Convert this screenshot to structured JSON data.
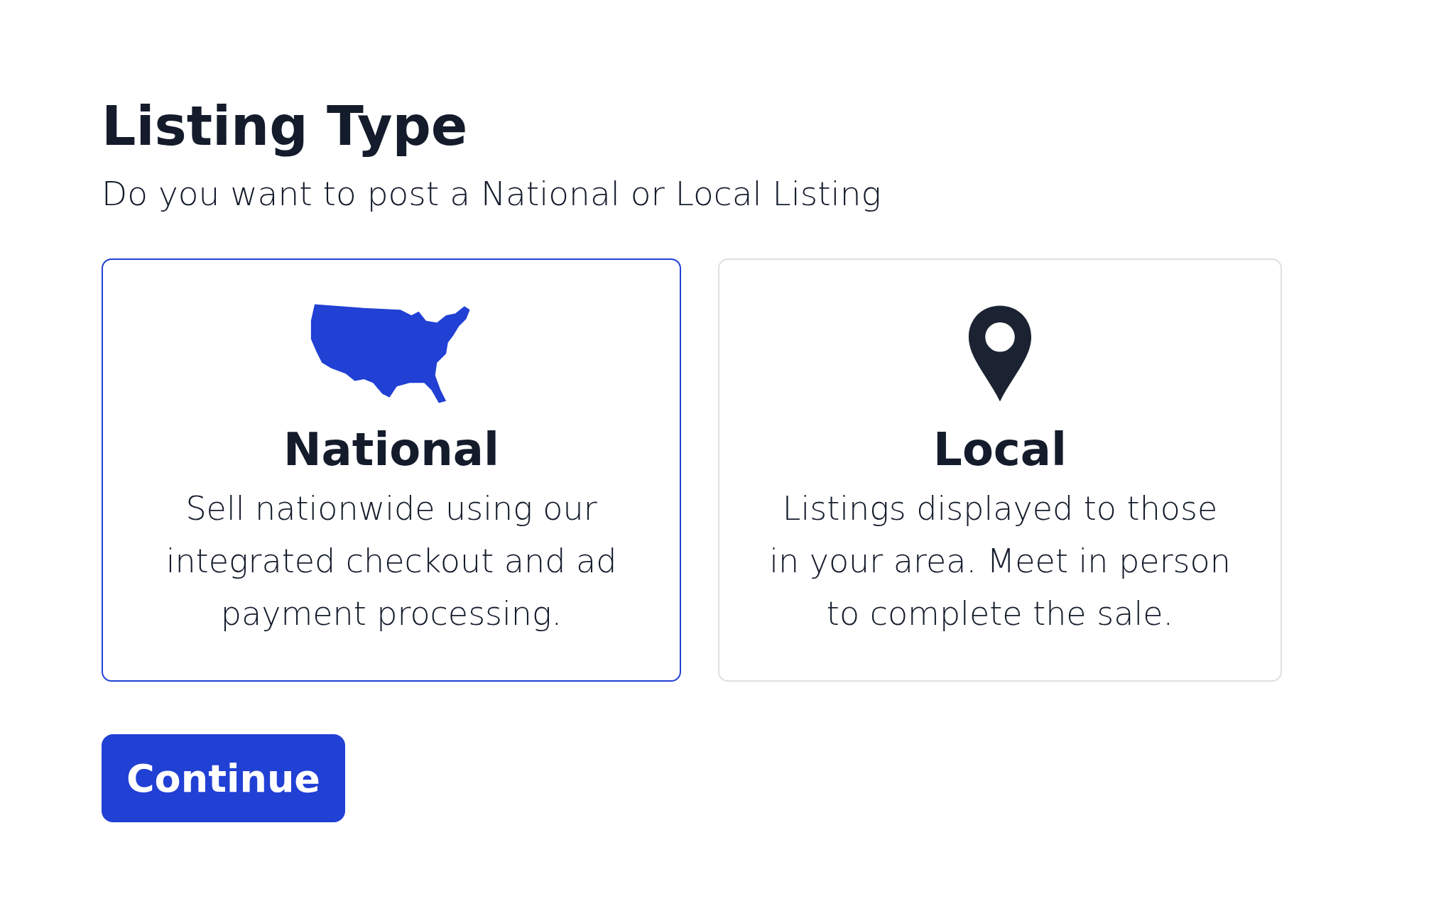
{
  "title": "Listing Type",
  "subtitle": "Do you want to post a National or Local Listing",
  "options": [
    {
      "kind": "map",
      "title": "National",
      "description_lines": [
        "Sell nationwide using our",
        "integrated checkout and ad",
        "payment processing."
      ],
      "selected": true
    },
    {
      "kind": "pin",
      "title": "Local",
      "description_lines": [
        "Listings displayed to those",
        "in your area. Meet in person",
        "to complete the sale."
      ],
      "selected": false
    }
  ],
  "button": "Continue"
}
